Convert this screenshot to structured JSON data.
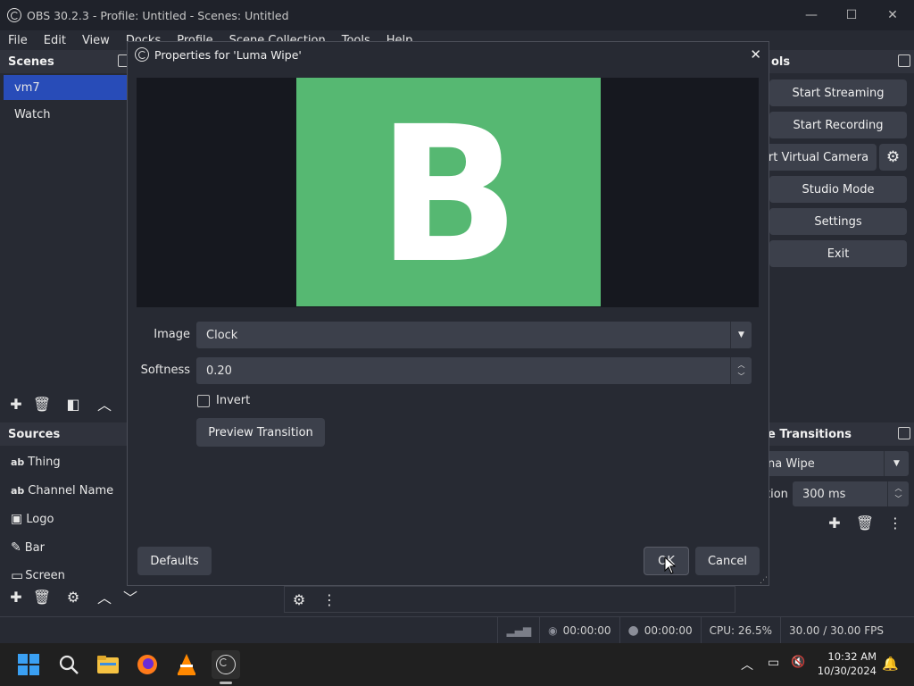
{
  "window": {
    "title": "OBS 30.2.3 - Profile: Untitled - Scenes: Untitled",
    "minimize": "—",
    "maximize": "☐",
    "close": "✕"
  },
  "menu": [
    "File",
    "Edit",
    "View",
    "Docks",
    "Profile",
    "Scene Collection",
    "Tools",
    "Help"
  ],
  "scenes": {
    "title": "Scenes",
    "items": [
      "vm7",
      "Watch"
    ],
    "selected_index": 0
  },
  "sources": {
    "title": "Sources",
    "items": [
      {
        "icon": "text-icon",
        "glyph": "ab",
        "label": "Thing"
      },
      {
        "icon": "text-icon",
        "glyph": "ab",
        "label": "Channel Name"
      },
      {
        "icon": "image-icon",
        "glyph": "▣",
        "label": "Logo"
      },
      {
        "icon": "brush-icon",
        "glyph": "✎",
        "label": "Bar"
      },
      {
        "icon": "display-icon",
        "glyph": "▭",
        "label": "Screen"
      }
    ]
  },
  "controls": {
    "title": "ols",
    "buttons": [
      "Start Streaming",
      "Start Recording",
      "rt Virtual Camera",
      "Studio Mode",
      "Settings",
      "Exit"
    ]
  },
  "transitions": {
    "title": "e Transitions",
    "selected": "na Wipe",
    "duration_label": "tion",
    "duration_value": "300 ms"
  },
  "dialog": {
    "title": "Properties for 'Luma Wipe'",
    "preview_letter": "B",
    "image_label": "Image",
    "image_value": "Clock",
    "softness_label": "Softness",
    "softness_value": "0.20",
    "invert_label": "Invert",
    "preview_button": "Preview Transition",
    "defaults_button": "Defaults",
    "ok_button": "OK",
    "cancel_button": "Cancel"
  },
  "status": {
    "stream_time": "00:00:00",
    "record_time": "00:00:00",
    "cpu": "CPU: 26.5%",
    "fps": "30.00 / 30.00 FPS"
  },
  "taskbar": {
    "time": "10:32 AM",
    "date": "10/30/2024",
    "apps": [
      "windows-start-icon",
      "search-icon",
      "file-explorer-icon",
      "firefox-icon",
      "vlc-icon",
      "obs-icon"
    ]
  },
  "colors": {
    "accent": "#284cb8",
    "preview_green": "#56b872"
  }
}
